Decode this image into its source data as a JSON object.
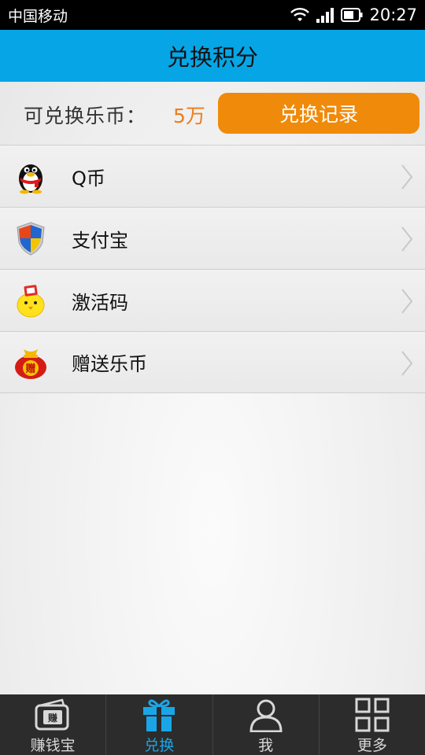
{
  "status_bar": {
    "carrier": "中国移动",
    "time": "20:27"
  },
  "header": {
    "title": "兑换积分"
  },
  "coins": {
    "label": "可兑换乐币：",
    "value": "5万",
    "record_button": "兑换记录"
  },
  "items": [
    {
      "label": "Q币",
      "icon": "qq-penguin-icon"
    },
    {
      "label": "支付宝",
      "icon": "alipay-shield-icon"
    },
    {
      "label": "激活码",
      "icon": "activation-chick-icon"
    },
    {
      "label": "赠送乐币",
      "icon": "gift-bag-icon"
    }
  ],
  "bottom_nav": [
    {
      "label": "赚钱宝",
      "icon": "wallet-icon"
    },
    {
      "label": "兑换",
      "icon": "gift-box-icon",
      "active": true
    },
    {
      "label": "我",
      "icon": "person-icon"
    },
    {
      "label": "更多",
      "icon": "grid-icon"
    }
  ],
  "colors": {
    "accent": "#06a6e6",
    "orange": "#f08a0a",
    "coin_value": "#f07c1c",
    "nav_active": "#1aa6e6"
  }
}
